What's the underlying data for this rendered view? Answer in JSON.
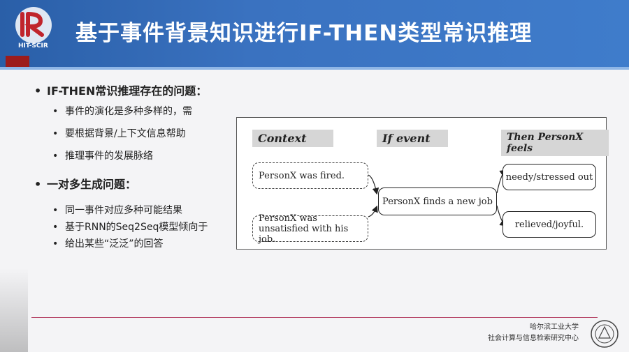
{
  "slide": {
    "title": "基于事件背景知识进行IF-THEN类型常识推理",
    "logo_text": "HIT-SCIR"
  },
  "bullets": [
    {
      "level": 1,
      "text": "IF-THEN常识推理存在的问题："
    },
    {
      "level": 2,
      "text": "事件的演化是多种多样的，需"
    },
    {
      "level": 2,
      "text": "要根据背景/上下文信息帮助"
    },
    {
      "level": 2,
      "text": "推理事件的发展脉络"
    },
    {
      "level": 1,
      "text": "一对多生成问题："
    },
    {
      "level": 2,
      "text": "同一事件对应多种可能结果"
    },
    {
      "level": 2,
      "text": "基于RNN的Seq2Seq模型倾向于"
    },
    {
      "level": 2,
      "text": "给出某些“泛泛”的回答"
    }
  ],
  "diagram": {
    "headers": {
      "context": "Context",
      "if_event": "If event",
      "then": "Then PersonX feels"
    },
    "context_nodes": [
      "PersonX was fired.",
      "PersonX was unsatisfied with his job."
    ],
    "event_node": "PersonX finds a new job",
    "result_nodes": [
      "needy/stressed out",
      "relieved/joyful."
    ]
  },
  "footer": {
    "line1": "哈尔滨工业大学",
    "line2": "社会计算与信息检索研究中心"
  },
  "colors": {
    "header": "#3a72c0",
    "accent": "#9c1c1c",
    "footer_line": "#b84a6b"
  }
}
